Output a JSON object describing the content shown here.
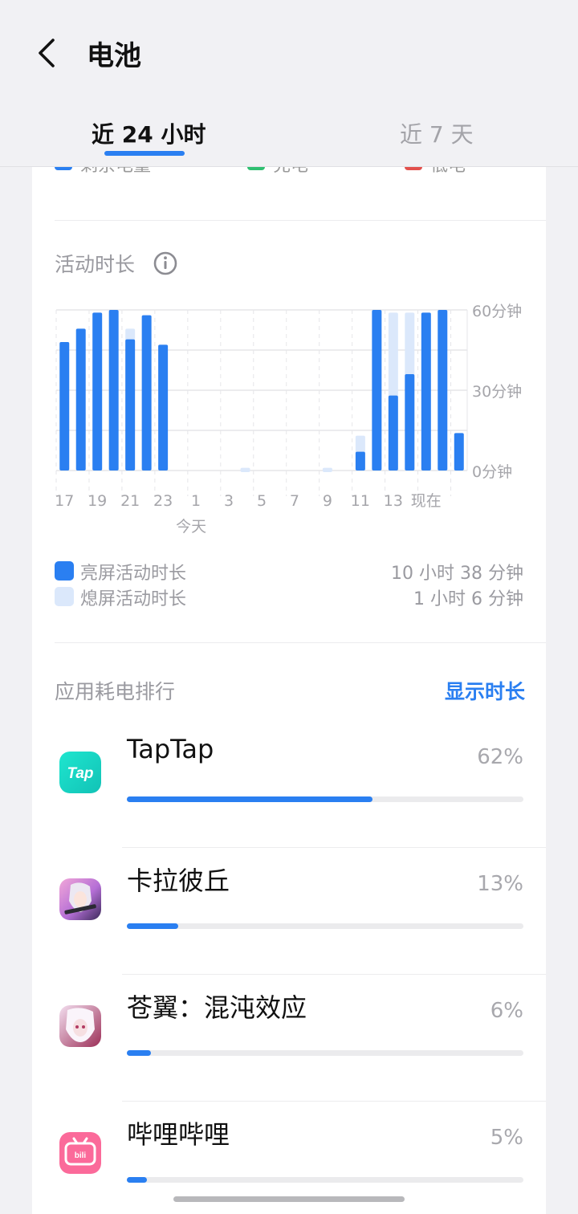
{
  "header": {
    "title": "电池"
  },
  "tabs": [
    {
      "label": "近 24 小时",
      "active": true
    },
    {
      "label": "近 7 天",
      "active": false
    }
  ],
  "battery_legend": [
    {
      "label": "剩余电量",
      "color": "#2a7ff1"
    },
    {
      "label": "充电",
      "color": "#2fbf71"
    },
    {
      "label": "低电",
      "color": "#e2504c"
    }
  ],
  "activity": {
    "title": "活动时长",
    "legend": [
      {
        "label": "亮屏活动时长",
        "value": "10 小时 38 分钟",
        "color": "#2a7ff1"
      },
      {
        "label": "熄屏活动时长",
        "value": "1 小时 6 分钟",
        "color": "#dbe8fb"
      }
    ]
  },
  "chart_data": {
    "type": "bar",
    "stacked": true,
    "x_tick_labels": [
      "17",
      "19",
      "21",
      "23",
      "1",
      "3",
      "5",
      "7",
      "9",
      "11",
      "13",
      "现在"
    ],
    "x_sublabel": "今天",
    "y_tick_labels": [
      "60分钟",
      "30分钟",
      "0分钟"
    ],
    "ylim": [
      0,
      60
    ],
    "grid": true,
    "series": [
      {
        "name": "亮屏活动时长",
        "color": "#2a7ff1",
        "values": [
          48,
          53,
          59,
          60,
          49,
          58,
          47,
          0,
          0,
          0,
          0,
          0,
          0,
          0,
          0,
          0,
          0,
          0,
          7,
          60,
          28,
          36,
          59,
          60,
          14
        ]
      },
      {
        "name": "熄屏活动时长",
        "color": "#dbe8fb",
        "values": [
          0,
          0,
          0,
          0,
          4,
          0,
          0,
          0,
          0,
          0,
          0,
          1,
          0,
          0,
          0,
          0,
          1,
          0,
          6,
          0,
          31,
          23,
          0,
          0,
          0
        ]
      }
    ]
  },
  "ranking": {
    "title": "应用耗电排行",
    "toggle_label": "显示时长",
    "apps": [
      {
        "name": "TapTap",
        "percent_label": "62%",
        "fraction": 0.62,
        "icon": "taptap-icon"
      },
      {
        "name": "卡拉彼丘",
        "percent_label": "13%",
        "fraction": 0.13,
        "icon": "strinova-icon"
      },
      {
        "name": "苍翼：混沌效应",
        "percent_label": "6%",
        "fraction": 0.06,
        "icon": "blazblue-icon"
      },
      {
        "name": "哔哩哔哩",
        "percent_label": "5%",
        "fraction": 0.05,
        "icon": "bilibili-icon"
      }
    ]
  }
}
